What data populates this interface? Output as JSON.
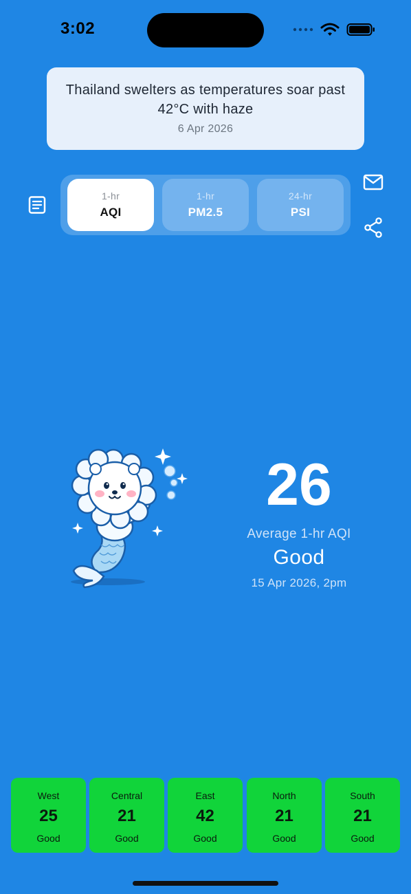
{
  "status_bar": {
    "time": "3:02"
  },
  "news": {
    "title": "Thailand swelters as temperatures soar past 42°C with haze",
    "date": "6 Apr 2026"
  },
  "tabs": [
    {
      "sub": "1-hr",
      "label": "AQI",
      "selected": true
    },
    {
      "sub": "1-hr",
      "label": "PM2.5",
      "selected": false
    },
    {
      "sub": "24-hr",
      "label": "PSI",
      "selected": false
    }
  ],
  "icons": {
    "left": "document-icon",
    "right_top": "mail-icon",
    "right_bottom": "share-icon"
  },
  "reading": {
    "value": "26",
    "label": "Average 1-hr AQI",
    "category": "Good",
    "timestamp": "15 Apr 2026, 2pm"
  },
  "regions": [
    {
      "name": "West",
      "value": "25",
      "category": "Good"
    },
    {
      "name": "Central",
      "value": "21",
      "category": "Good"
    },
    {
      "name": "East",
      "value": "42",
      "category": "Good"
    },
    {
      "name": "North",
      "value": "21",
      "category": "Good"
    },
    {
      "name": "South",
      "value": "21",
      "category": "Good"
    }
  ],
  "colors": {
    "background": "#1f86e4",
    "good": "#11d43a",
    "selected_tab": "#ffffff",
    "unselected_tab": "#74b3ee"
  }
}
